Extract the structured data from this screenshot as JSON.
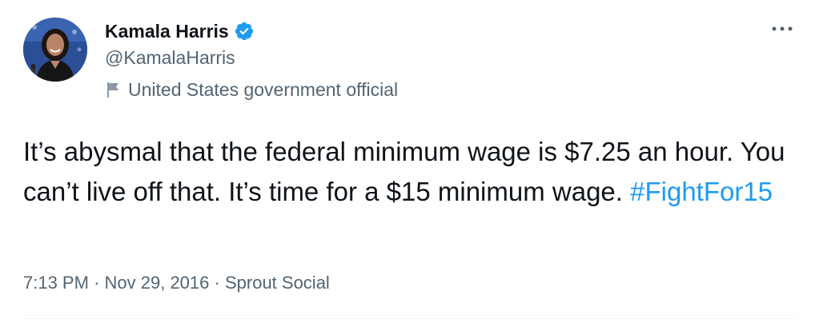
{
  "author": {
    "display_name": "Kamala Harris",
    "handle": "@KamalaHarris",
    "verified": true,
    "avatar_icon": "profile-photo"
  },
  "label": {
    "icon": "flag-icon",
    "text": "United States government official"
  },
  "tweet": {
    "text_before": "It’s abysmal that the federal minimum wage is $7.25 an hour. You can’t live off that. It’s time for a $15 minimum wage. ",
    "hashtag": "#FightFor15"
  },
  "meta": {
    "time": "7:13 PM",
    "separator": "·",
    "date": "Nov 29, 2016",
    "source": "Sprout Social"
  },
  "more_icon": "more-icon",
  "colors": {
    "text": "#0f1419",
    "secondary": "#536471",
    "link": "#1d9bf0",
    "verified": "#1d9bf0"
  }
}
